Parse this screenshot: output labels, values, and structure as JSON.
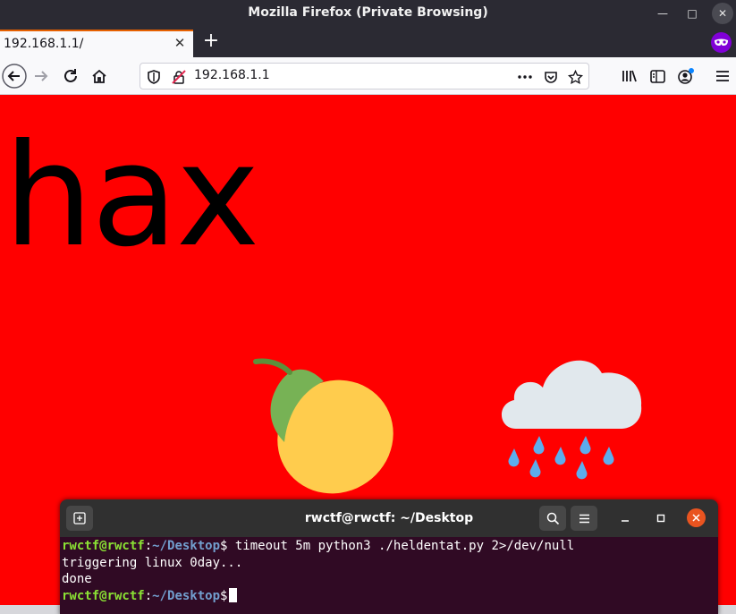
{
  "window": {
    "title": "Mozilla Firefox (Private Browsing)"
  },
  "tabs": [
    {
      "label": "192.168.1.1/"
    }
  ],
  "navbar": {
    "url": "192.168.1.1"
  },
  "icons": {
    "back": "back-arrow-icon",
    "forward": "forward-arrow-icon",
    "reload": "reload-icon",
    "home": "home-icon",
    "shield": "tracking-protection-shield-icon",
    "insecure": "insecure-lock-icon",
    "page_actions": "more-dots-icon",
    "pocket": "pocket-icon",
    "bookmark": "bookmark-star-icon",
    "library": "library-icon",
    "sidebar": "sidebar-icon",
    "account": "account-icon",
    "menu": "hamburger-menu-icon",
    "private": "private-browsing-mask-icon"
  },
  "page": {
    "heading": "hax",
    "emoji": [
      "lemon",
      "cloud-with-rain"
    ],
    "background": "#ff0000"
  },
  "terminal": {
    "title": "rwctf@rwctf: ~/Desktop",
    "prompt_user": "rwctf@rwctf",
    "prompt_sep": ":",
    "prompt_path": "~/Desktop",
    "prompt_symbol": "$",
    "command": " timeout 5m python3 ./heldentat.py 2>/dev/null",
    "output": [
      "triggering linux 0day...",
      "done"
    ],
    "colors": {
      "background": "#300a24",
      "user": "#8ae234",
      "path": "#729fcf",
      "close": "#e95420"
    }
  }
}
